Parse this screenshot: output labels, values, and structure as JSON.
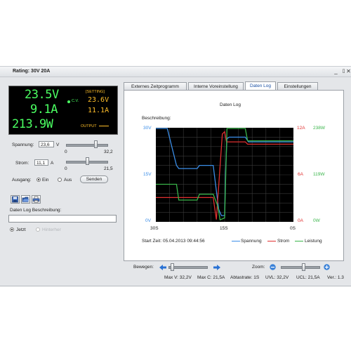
{
  "window": {
    "title": "Rating: 30V 20A",
    "controls": {
      "minimize": "_",
      "maximize": "▯",
      "close": "✕"
    }
  },
  "lcd": {
    "voltage": "23.5V",
    "current": "9.1A",
    "power": "213.9W",
    "setting_label": "[SETTING]",
    "mode": "C.V.",
    "set_voltage": "23.6V",
    "set_current": "11.1A",
    "output_label": "OUTPUT"
  },
  "controls": {
    "spannung_label": "Spannung:",
    "spannung_value": "23,6",
    "spannung_unit": "V",
    "spannung_min": "0",
    "spannung_max": "32,2",
    "spannung_level": 0.73,
    "strom_label": "Strom:",
    "strom_value": "11,1",
    "strom_unit": "A",
    "strom_min": "0",
    "strom_max": "21,5",
    "strom_level": 0.52,
    "ausgang_label": "Ausgang:",
    "ein_label": "Ein",
    "aus_label": "Aus",
    "senden_label": "Senden"
  },
  "log": {
    "beschreibung_label": "Daten Log Beschreibung:",
    "beschreibung_value": "",
    "jetzt_label": "Jetzt",
    "hinterher_label": "Hinterher"
  },
  "tabs": [
    {
      "label": "Externes Zeitprogramm",
      "active": false
    },
    {
      "label": "Interne Voreinstellung",
      "active": false
    },
    {
      "label": "Daten Log",
      "active": true
    },
    {
      "label": "Einstellungen",
      "active": false
    }
  ],
  "chart": {
    "title": "Daten Log",
    "beschreibung": "Beschreibung:",
    "start_time": "Start Zeit: 05.04.2013 09:44:56",
    "colors": {
      "voltage": "#3b8ee8",
      "current": "#e03030",
      "power": "#39b54a"
    }
  },
  "chart_data": {
    "type": "line",
    "title": "Daten Log",
    "x_ticks": [
      "30S",
      "15S",
      "0S"
    ],
    "y_left_ticks": [
      "30V",
      "15V",
      "0V"
    ],
    "y_mid_ticks": [
      "12A",
      "6A",
      "0A"
    ],
    "y_right_ticks": [
      "238W",
      "119W",
      "0W"
    ],
    "xlim": [
      30,
      0
    ],
    "grid": true,
    "legend_position": "bottom-right",
    "series": [
      {
        "name": "Spannung",
        "unit": "V",
        "ylim": [
          0,
          30
        ],
        "x": [
          30,
          27.5,
          25.5,
          25,
          21,
          20.5,
          17.5,
          16.3,
          15.7,
          15,
          14.8,
          14.5,
          14,
          10.5,
          9.8,
          6,
          0
        ],
        "y": [
          30,
          30,
          18,
          17,
          17,
          18,
          18,
          4,
          2,
          2,
          16,
          26.5,
          27,
          27,
          25.5,
          25.5,
          25.5
        ]
      },
      {
        "name": "Strom",
        "unit": "A",
        "ylim": [
          0,
          12
        ],
        "x": [
          30,
          17.5,
          16.8,
          15.5,
          15,
          14.6,
          14,
          10.5,
          10,
          0
        ],
        "y": [
          3.1,
          3.1,
          0.3,
          11.2,
          11.5,
          10.2,
          10.2,
          10.2,
          9.9,
          9.9
        ]
      },
      {
        "name": "Leistung",
        "unit": "W",
        "ylim": [
          0,
          238
        ],
        "x": [
          30,
          25.5,
          25,
          21,
          20.5,
          17.5,
          16.5,
          16,
          15,
          14.5,
          14,
          10.5,
          10,
          0
        ],
        "y": [
          95,
          95,
          55,
          55,
          70,
          70,
          40,
          5,
          10,
          240,
          238,
          238,
          205,
          205
        ]
      }
    ]
  },
  "bottom": {
    "bewegen_label": "Bewegen:",
    "zoom_label": "Zoom:",
    "bewegen_level": 0.1,
    "zoom_level": 0.6,
    "max_v": "Max V: 32,2V",
    "max_c": "Max C: 21,5A",
    "abtastrate": "Abtastrate: 1S",
    "uvl": "UVL: 32,2V",
    "ucl": "UCL: 21,5A",
    "ver": "Ver.: 1.3"
  }
}
